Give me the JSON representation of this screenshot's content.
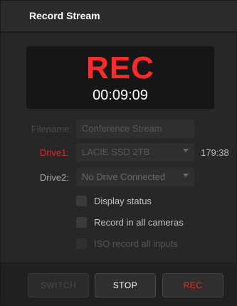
{
  "header": {
    "title": "Record Stream"
  },
  "recording": {
    "indicator": "REC",
    "timecode": "00:09:09"
  },
  "filename": {
    "label": "Filename:",
    "value": "Conference Stream"
  },
  "drive1": {
    "label": "Drive1:",
    "value": "LACIE SSD 2TB",
    "time_remaining": "179:38"
  },
  "drive2": {
    "label": "Drive2:",
    "value": "No Drive Connected"
  },
  "options": [
    {
      "label": "Display status",
      "checked": false,
      "enabled": true
    },
    {
      "label": "Record in all cameras",
      "checked": false,
      "enabled": true
    },
    {
      "label": "ISO record all inputs",
      "checked": false,
      "enabled": false
    }
  ],
  "buttons": {
    "switch": "SWITCH",
    "stop": "STOP",
    "rec": "REC"
  },
  "colors": {
    "rec_red": "#ff2a2a",
    "drive1_label_red": "#d62a2a",
    "background": "#272727"
  }
}
